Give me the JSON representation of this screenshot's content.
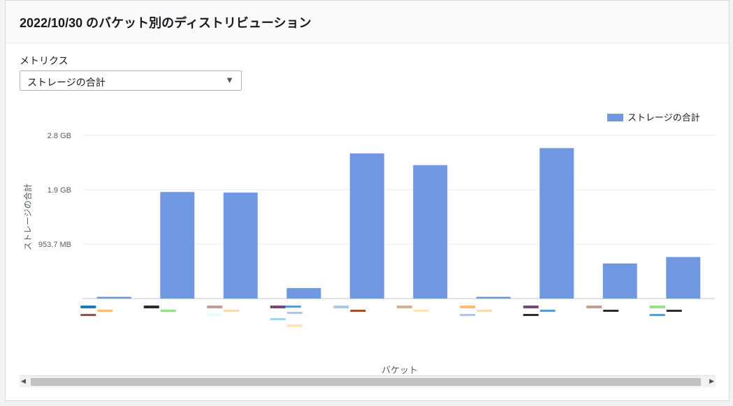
{
  "panel": {
    "title": "2022/10/30 のバケット別のディストリビューション"
  },
  "metric_selector": {
    "label": "メトリクス",
    "selected": "ストレージの合計",
    "caret": "▼"
  },
  "scrollbar": {
    "left_arrow": "◀",
    "right_arrow": "▶"
  },
  "colors": {
    "bar": "#7097e1",
    "grid": "#e9ebed",
    "axis_text": "#545b64",
    "swatch_palette": [
      "#1f77b4",
      "#ffbb78",
      "#8c564b",
      "#2c2c2c",
      "#98df8a",
      "#c49c94",
      "#f7d9b4",
      "#e0ffff",
      "#7b4a7b",
      "#aec7e8",
      "#9edae5",
      "#ffe4b5",
      "#5a9bd4",
      "#a0522d",
      "#d2b48c"
    ]
  },
  "chart_data": {
    "type": "bar",
    "xlabel": "バケット",
    "ylabel": "ストレージの合計",
    "legend": {
      "position": "top-right",
      "entries": [
        "ストレージの合計"
      ]
    },
    "grid": true,
    "y_unit": "GB",
    "ylim": [
      0,
      2.8
    ],
    "yticks": [
      {
        "value": 0.93,
        "label": "953.7 MB"
      },
      {
        "value": 1.86,
        "label": "1.9 GB"
      },
      {
        "value": 2.79,
        "label": "2.8 GB"
      }
    ],
    "series": [
      {
        "name": "ストレージの合計",
        "values": [
          0.03,
          1.82,
          1.81,
          0.18,
          2.48,
          2.28,
          0.03,
          2.57,
          0.6,
          0.71
        ]
      }
    ],
    "category_label_swatches": [
      [
        0,
        1,
        2
      ],
      [
        3,
        4
      ],
      [
        5,
        6,
        7
      ],
      [
        8,
        9,
        10,
        11,
        12
      ],
      [
        9,
        13
      ],
      [
        14,
        11
      ],
      [
        1,
        6,
        9
      ],
      [
        8,
        12,
        3
      ],
      [
        5,
        3
      ],
      [
        4,
        3,
        12
      ]
    ]
  }
}
